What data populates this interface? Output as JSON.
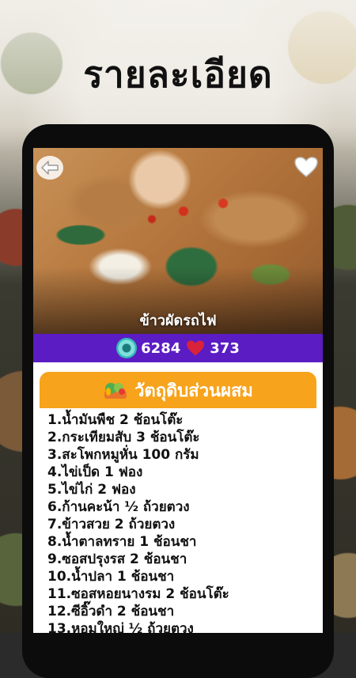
{
  "header": {
    "title": "รายละเอียด"
  },
  "recipe": {
    "name": "ข้าวผัดรถไฟ",
    "views": "6284",
    "likes": "373"
  },
  "ingredients": {
    "title": "วัตถุดิบส่วนผสม",
    "items": [
      "1.น้ำมันพืช 2 ช้อนโต๊ะ",
      "2.กระเทียมสับ 3 ช้อนโต๊ะ",
      "3.สะโพกหมูหั่น 100 กรัม",
      "4.ไข่เป็ด 1 ฟอง",
      "5.ไข่ไก่ 2 ฟอง",
      "6.ก้านคะน้า ½ ถ้วยตวง",
      "7.ข้าวสวย 2 ถ้วยตวง",
      "8.น้ำตาลทราย 1 ช้อนชา",
      "9.ซอสปรุงรส 2 ช้อนชา",
      "10.น้ำปลา 1 ช้อนชา",
      "11.ซอสหอยนางรม 2 ช้อนโต๊ะ",
      "12.ซีอิ๊วดำ 2 ช้อนชา",
      "13.หอมใหญ่ ½ ถ้วยตวง"
    ]
  },
  "icons": {
    "back": "back-arrow-icon",
    "favorite": "heart-icon",
    "views": "eye-icon",
    "likes": "heart-icon",
    "ingredients": "vegetables-icon"
  },
  "colors": {
    "stats_bar": "#5b1cc4",
    "section_header": "#f7a31c",
    "heart": "#d9233a",
    "eye": "#35b8b4"
  }
}
